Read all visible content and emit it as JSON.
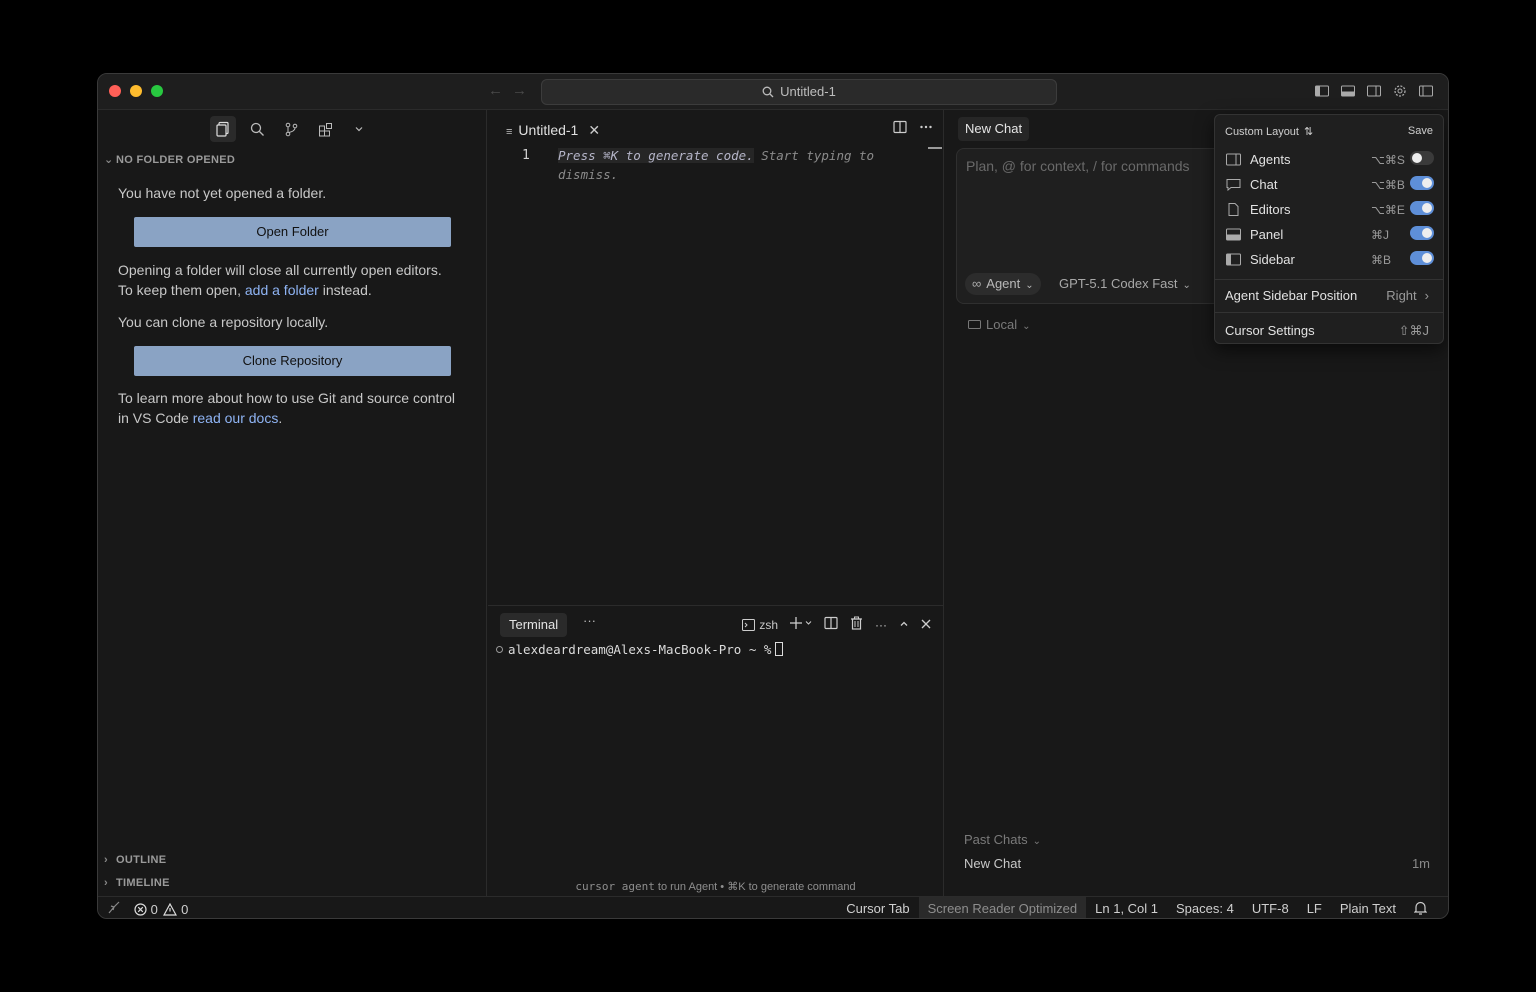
{
  "titlebar": {
    "search_text": "Untitled-1"
  },
  "sidebar": {
    "section_title": "NO FOLDER OPENED",
    "msg_no_folder": "You have not yet opened a folder.",
    "open_folder_label": "Open Folder",
    "msg_close_editors_1": "Opening a folder will close all currently open editors.",
    "msg_close_editors_2a": "To keep them open, ",
    "link_add_folder": "add a folder",
    "msg_close_editors_2b": " instead.",
    "msg_clone": "You can clone a repository locally.",
    "clone_label": "Clone Repository",
    "msg_learn_1": "To learn more about how to use Git and source control",
    "msg_learn_2a": "in VS Code ",
    "link_docs": "read our docs",
    "msg_learn_2b": ".",
    "outline_label": "OUTLINE",
    "timeline_label": "TIMELINE"
  },
  "editor": {
    "tab_label": "Untitled-1",
    "line_number": "1",
    "ghost_hl": "Press ⌘K to generate code.",
    "ghost_rest": " Start typing to dismiss."
  },
  "terminal": {
    "tab_label": "Terminal",
    "shell_label": "zsh",
    "prompt": "alexdeardream@Alexs-MacBook-Pro ~ %",
    "hint_cmd": "cursor agent",
    "hint_rest": " to run Agent • ⌘K to generate command"
  },
  "chat": {
    "tab_label": "New Chat",
    "placeholder": "Plan, @ for context, / for commands",
    "agent_label": "Agent",
    "model_label": "GPT-5.1 Codex Fast",
    "local_label": "Local",
    "past_chats_label": "Past Chats",
    "past_item_label": "New Chat",
    "past_item_time": "1m"
  },
  "layout_menu": {
    "header": "Custom Layout",
    "save_label": "Save",
    "toggles": [
      {
        "label": "Agents",
        "shortcut": "⌥⌘S",
        "on": false
      },
      {
        "label": "Chat",
        "shortcut": "⌥⌘B",
        "on": true
      },
      {
        "label": "Editors",
        "shortcut": "⌥⌘E",
        "on": true
      },
      {
        "label": "Panel",
        "shortcut": "⌘J",
        "on": true
      },
      {
        "label": "Sidebar",
        "shortcut": "⌘B",
        "on": true
      }
    ],
    "position_label": "Agent Sidebar Position",
    "position_value": "Right",
    "settings_label": "Cursor Settings",
    "settings_shortcut": "⇧⌘J"
  },
  "statusbar": {
    "errors": "0",
    "warnings": "0",
    "cursor_tab": "Cursor Tab",
    "screen_reader": "Screen Reader Optimized",
    "position": "Ln 1, Col 1",
    "spaces": "Spaces: 4",
    "encoding": "UTF-8",
    "eol": "LF",
    "language": "Plain Text"
  },
  "colors": {
    "accent": "#5e8fd8",
    "button": "#8aa3c4",
    "link": "#8fb4f4"
  }
}
